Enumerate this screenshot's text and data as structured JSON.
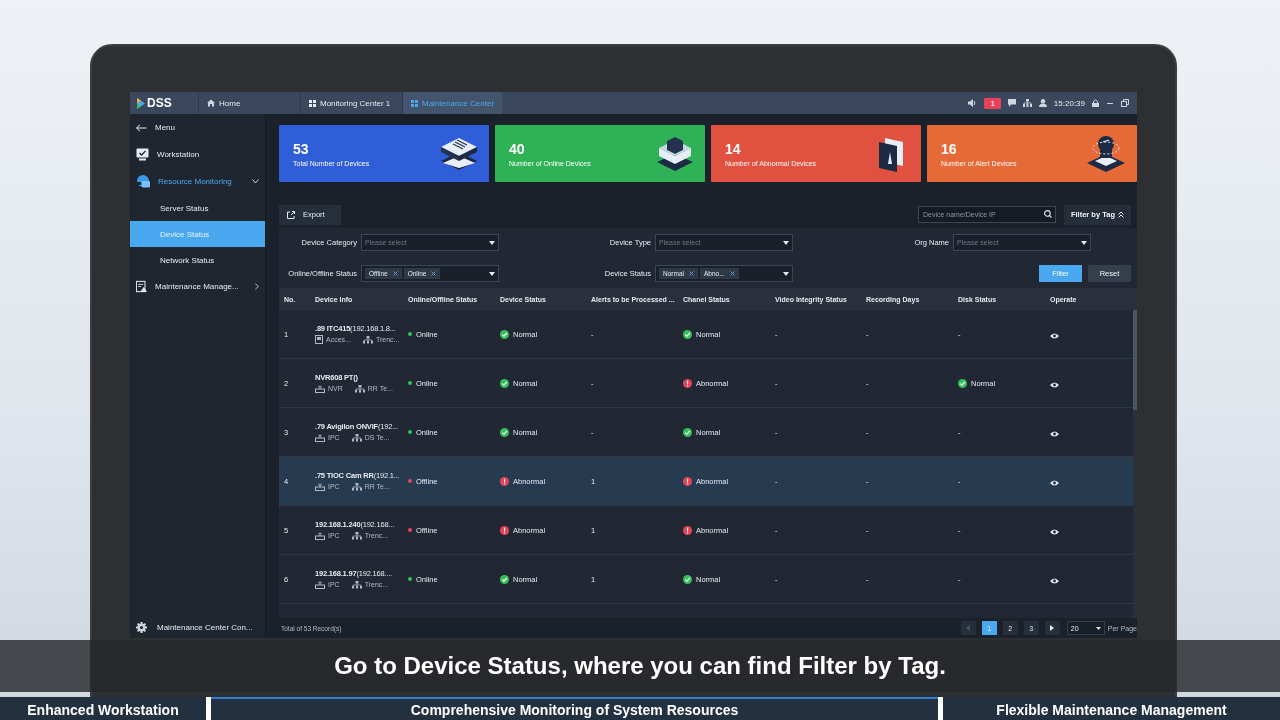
{
  "app": {
    "logo": "DSS"
  },
  "tabs": [
    {
      "label": "Home",
      "selected": false
    },
    {
      "label": "Monitoring Center 1",
      "selected": false
    },
    {
      "label": "Maintenance Center",
      "selected": true
    }
  ],
  "status_area": {
    "alarm_count": "1",
    "time": "15:20:39"
  },
  "sidebar": {
    "menu_label": "Menu",
    "items": [
      {
        "label": "Workstation",
        "expanded": false,
        "active": false
      },
      {
        "label": "Resource Monitoring",
        "expanded": true,
        "active": true,
        "children": [
          {
            "label": "Server Status",
            "selected": false
          },
          {
            "label": "Device Status",
            "selected": true
          },
          {
            "label": "Network Status",
            "selected": false
          }
        ]
      },
      {
        "label": "Maintenance Manage...",
        "expanded": false,
        "active": false
      }
    ],
    "footer": "Maintenance Center Con..."
  },
  "cards": [
    {
      "value": "53",
      "label": "Total Number of Devices",
      "color": "#2f5ed8",
      "kind": "layers"
    },
    {
      "value": "40",
      "label": "Number of Online Devices",
      "color": "#2fb255",
      "kind": "cube"
    },
    {
      "value": "14",
      "label": "Number of Abnormal Devices",
      "color": "#e0523f",
      "kind": "book"
    },
    {
      "value": "16",
      "label": "Number of Alert Devices",
      "color": "#e66a38",
      "kind": "alarm"
    }
  ],
  "toolbar": {
    "export": "Export",
    "search_placeholder": "Device name/Device IP",
    "filter_by_tag": "Filter by Tag"
  },
  "filters": [
    {
      "label": "Device Category",
      "placeholder": "Please select"
    },
    {
      "label": "Device Type",
      "placeholder": "Please select"
    },
    {
      "label": "Org Name",
      "placeholder": "Please select"
    },
    {
      "label": "Online/Offline Status",
      "tags": [
        "Offline",
        "Online"
      ]
    },
    {
      "label": "Device Status",
      "tags": [
        "Normal",
        "Abno..."
      ]
    }
  ],
  "filter_buttons": {
    "filter": "Filter",
    "reset": "Reset"
  },
  "table": {
    "columns": [
      "No.",
      "Device Info",
      "Online/Offline Status",
      "Device Status",
      "Alerts to be Processed ...",
      "Chanel Status",
      "Video Integrity Status",
      "Recording Days",
      "Disk Status",
      "Operate"
    ],
    "rows": [
      {
        "no": "1",
        "name": "**.89 ITC415**(192.168.1.8...",
        "type": "Acces...",
        "kind": "access",
        "org": "Trenc...",
        "online": {
          "text": "Online",
          "on": true
        },
        "device_status": {
          "text": "Normal",
          "kind": "ok"
        },
        "alerts": "-",
        "channel_status": {
          "text": "Normal",
          "kind": "ok"
        },
        "video": "-",
        "recording": "-",
        "disk_status": {
          "text": "-",
          "kind": "none"
        },
        "selected": false
      },
      {
        "no": "2",
        "name": "**NVR608 PT()**",
        "type": "NVR",
        "kind": "recorder",
        "org": "RR Te...",
        "online": {
          "text": "Online",
          "on": true
        },
        "device_status": {
          "text": "Normal",
          "kind": "ok"
        },
        "alerts": "-",
        "channel_status": {
          "text": "Abnormal",
          "kind": "error"
        },
        "video": "-",
        "recording": "-",
        "disk_status": {
          "text": "Normal",
          "kind": "ok"
        },
        "selected": false
      },
      {
        "no": "3",
        "name": "**.79 Avigilon ONVIF**(192...",
        "type": "IPC",
        "kind": "recorder",
        "org": "DS Te...",
        "online": {
          "text": "Online",
          "on": true
        },
        "device_status": {
          "text": "Normal",
          "kind": "ok"
        },
        "alerts": "-",
        "channel_status": {
          "text": "Normal",
          "kind": "ok"
        },
        "video": "-",
        "recording": "-",
        "disk_status": {
          "text": "-",
          "kind": "none"
        },
        "selected": false
      },
      {
        "no": "4",
        "name": "**.75 TIOC Cam RR**(192.1...",
        "type": "IPC",
        "kind": "recorder",
        "org": "RR Te...",
        "online": {
          "text": "Offline",
          "on": false
        },
        "device_status": {
          "text": "Abnormal",
          "kind": "error"
        },
        "alerts": "1",
        "channel_status": {
          "text": "Abnormal",
          "kind": "error"
        },
        "video": "-",
        "recording": "-",
        "disk_status": {
          "text": "-",
          "kind": "none"
        },
        "selected": true
      },
      {
        "no": "5",
        "name": "**192.168.1.240**(192.168...",
        "type": "IPC",
        "kind": "recorder",
        "org": "Trenc...",
        "online": {
          "text": "Offline",
          "on": false
        },
        "device_status": {
          "text": "Abnormal",
          "kind": "error"
        },
        "alerts": "1",
        "channel_status": {
          "text": "Abnormal",
          "kind": "error"
        },
        "video": "-",
        "recording": "-",
        "disk_status": {
          "text": "-",
          "kind": "none"
        },
        "selected": false
      },
      {
        "no": "6",
        "name": "**192.168.1.97**(192.168....",
        "type": "IPC",
        "kind": "recorder",
        "org": "Trenc...",
        "online": {
          "text": "Online",
          "on": true
        },
        "device_status": {
          "text": "Normal",
          "kind": "ok"
        },
        "alerts": "1",
        "channel_status": {
          "text": "Normal",
          "kind": "ok"
        },
        "video": "-",
        "recording": "-",
        "disk_status": {
          "text": "-",
          "kind": "none"
        },
        "selected": false
      }
    ]
  },
  "pagination": {
    "total": "Total of 53 Record(s)",
    "pages": [
      {
        "label": "1",
        "selected": true
      },
      {
        "label": "2",
        "selected": false
      },
      {
        "label": "3",
        "selected": false
      }
    ],
    "prev_disabled": true,
    "page_size": "20",
    "per_page": "Per Page"
  },
  "subtitle": "Go to Device Status, where you can find Filter by Tag.",
  "chapter_bar": [
    {
      "label": "Enhanced Workstation",
      "selected": false
    },
    {
      "label": "Comprehensive Monitoring of System Resources",
      "selected": true
    },
    {
      "label": "Flexible Maintenance Management",
      "selected": false
    }
  ]
}
